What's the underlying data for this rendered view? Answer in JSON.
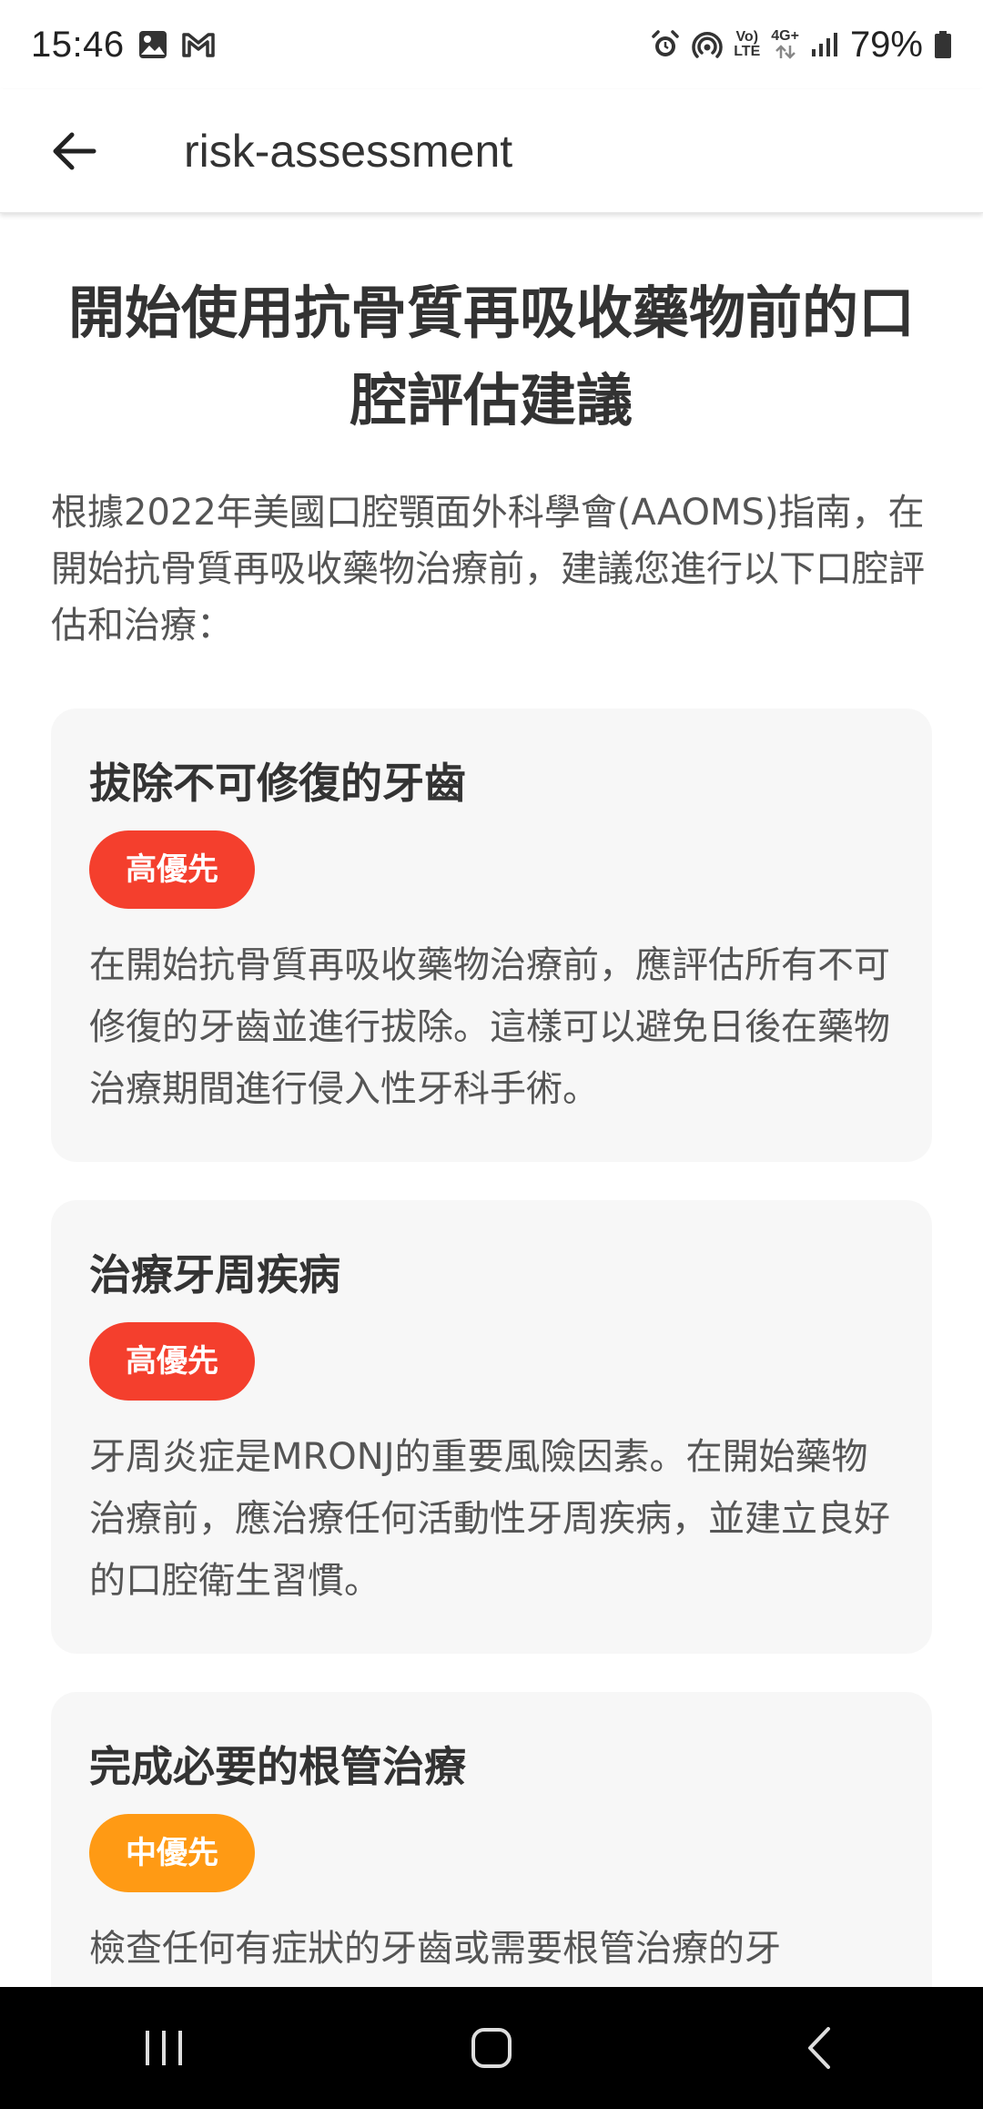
{
  "status_bar": {
    "time": "15:46",
    "battery": "79%",
    "network_top": "Vo)",
    "network_bottom": "LTE",
    "signal_type": "4G+",
    "icons": [
      "image-icon",
      "gmail-icon",
      "alarm-icon",
      "hotspot-icon",
      "volte-icon",
      "data-arrows-icon",
      "signal-icon",
      "battery-icon"
    ]
  },
  "app_bar": {
    "title": "risk-assessment",
    "back_icon": "arrow-left-icon"
  },
  "page": {
    "title": "開始使用抗骨質再吸收藥物前的口腔評估建議",
    "intro": "根據2022年美國口腔顎面外科學會(AAOMS)指南，在開始抗骨質再吸收藥物治療前，建議您進行以下口腔評估和治療："
  },
  "cards": [
    {
      "title": "拔除不可修復的牙齒",
      "priority": "高優先",
      "priority_level": "high",
      "description": "在開始抗骨質再吸收藥物治療前，應評估所有不可修復的牙齒並進行拔除。這樣可以避免日後在藥物治療期間進行侵入性牙科手術。"
    },
    {
      "title": "治療牙周疾病",
      "priority": "高優先",
      "priority_level": "high",
      "description": "牙周炎症是MRONJ的重要風險因素。在開始藥物治療前，應治療任何活動性牙周疾病，並建立良好的口腔衛生習慣。"
    },
    {
      "title": "完成必要的根管治療",
      "priority": "中優先",
      "priority_level": "medium",
      "description": "檢查任何有症狀的牙齒或需要根管治療的牙"
    }
  ],
  "colors": {
    "high_priority": "#f43f2d",
    "medium_priority": "#ff9a14",
    "card_background": "#f7f7f7",
    "nav_bar": "#000000"
  },
  "nav_bar": {
    "buttons": [
      "recent-apps-icon",
      "home-icon",
      "back-icon"
    ]
  }
}
